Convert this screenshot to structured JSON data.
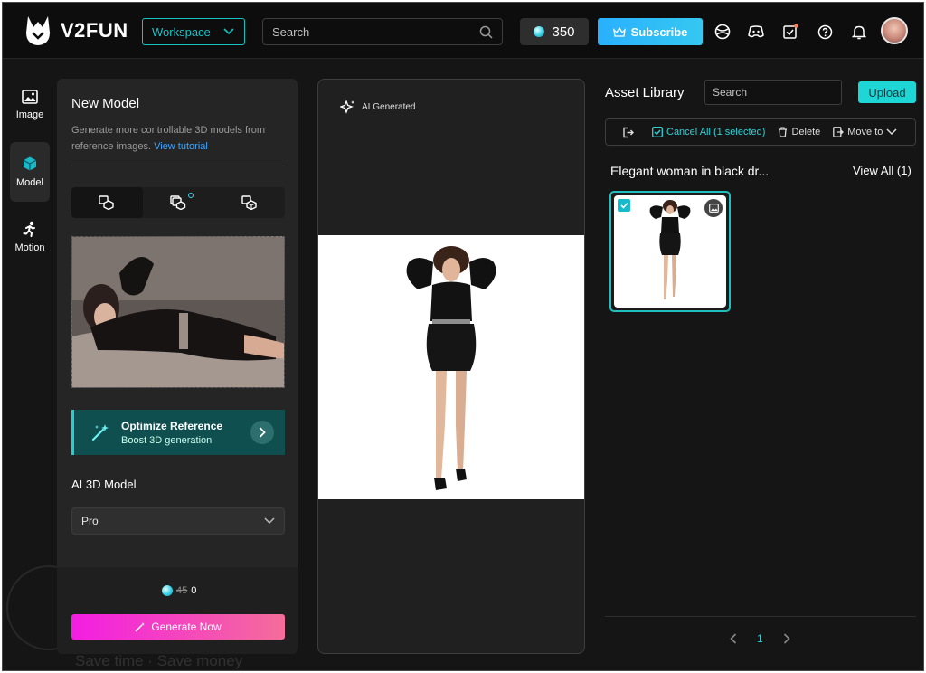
{
  "app": {
    "brand": "V2FUN"
  },
  "header": {
    "workspace_label": "Workspace",
    "search_placeholder": "Search",
    "credits": "350",
    "subscribe_label": "Subscribe"
  },
  "rail": {
    "items": [
      {
        "label": "Image",
        "icon": "image-icon"
      },
      {
        "label": "Model",
        "icon": "cube-icon"
      },
      {
        "label": "Motion",
        "icon": "running-figure-icon"
      }
    ]
  },
  "model_panel": {
    "title": "New Model",
    "description": "Generate more controllable 3D models from reference images.",
    "tutorial_link": "View tutorial",
    "optimize": {
      "title": "Optimize Reference",
      "subtitle": "Boost 3D generation"
    },
    "model_section_label": "AI 3D Model",
    "model_value": "Pro",
    "cost_original": "45",
    "cost_current": "0",
    "generate_label": "Generate Now"
  },
  "preview": {
    "badge": "AI Generated"
  },
  "library": {
    "title": "Asset Library",
    "search_placeholder": "Search",
    "upload_label": "Upload",
    "toolbar": {
      "cancel_all": "Cancel All (1 selected)",
      "delete": "Delete",
      "move_to": "Move to"
    },
    "group_title": "Elegant woman in black dr...",
    "view_all": "View All (1)",
    "page": "1"
  },
  "watermark": "Save time · Save money",
  "colors": {
    "accent": "#1ed6d6",
    "generate_start": "#f31de3",
    "generate_end": "#f56d9a",
    "subscribe": "#2ab0ff"
  }
}
